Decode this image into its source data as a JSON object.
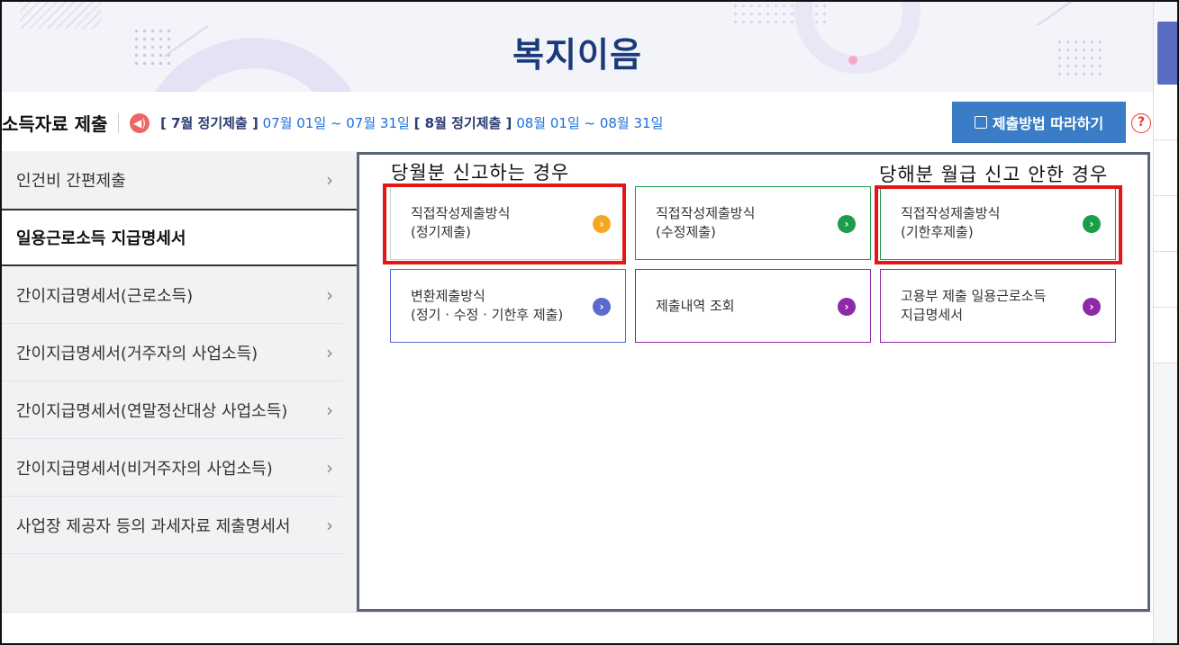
{
  "app": {
    "title": "복지이음"
  },
  "subheader": {
    "section_title": "소득자료 제출",
    "notice_icon": "speaker-icon",
    "notice": [
      {
        "label": "[ 7월 정기제출 ]",
        "dates": "07월 01일 ~ 07월 31일"
      },
      {
        "label": "[ 8월 정기제출 ]",
        "dates": "08월 01일 ~ 08월 31일"
      }
    ],
    "guide_button": "제출방법 따라하기",
    "help_icon": "?"
  },
  "sidebar": {
    "items": [
      {
        "label": "인건비 간편제출",
        "active": false
      },
      {
        "label": "일용근로소득 지급명세서",
        "active": true
      },
      {
        "label": "간이지급명세서(근로소득)",
        "active": false
      },
      {
        "label": "간이지급명세서(거주자의 사업소득)",
        "active": false
      },
      {
        "label": "간이지급명세서(연말정산대상 사업소득)",
        "active": false
      },
      {
        "label": "간이지급명세서(비거주자의 사업소득)",
        "active": false
      },
      {
        "label": "사업장 제공자 등의 과세자료 제출명세서",
        "active": false
      }
    ],
    "chevron": "›"
  },
  "annotations": {
    "left_note": "당월분 신고하는 경우",
    "right_note": "당해분 월급 신고 안한 경우"
  },
  "cards": [
    {
      "line1": "직접작성제출방식",
      "line2": "(정기제출)",
      "color": "#f5a623",
      "border": "#cfcfcf"
    },
    {
      "line1": "직접작성제출방식",
      "line2": "(수정제출)",
      "color": "#1a9e4b",
      "border": "#1a9e4b"
    },
    {
      "line1": "직접작성제출방식",
      "line2": "(기한후제출)",
      "color": "#1a9e4b",
      "border": "#1a9e4b"
    },
    {
      "line1": "변환제출방식",
      "line2": "(정기 · 수정 · 기한후 제출)",
      "color": "#5b6ad0",
      "border": "#5b6ad0"
    },
    {
      "line1": "제출내역 조회",
      "line2": "",
      "color": "#8e2aa8",
      "border": "#8e2aa8"
    },
    {
      "line1": "고용부 제출 일용근로소득",
      "line2": "지급명세서",
      "color": "#8e2aa8",
      "border": "#8e2aa8"
    }
  ],
  "colors": {
    "accent": "#3a7dc6",
    "title": "#1a3a7a",
    "highlight": "#e41616"
  }
}
